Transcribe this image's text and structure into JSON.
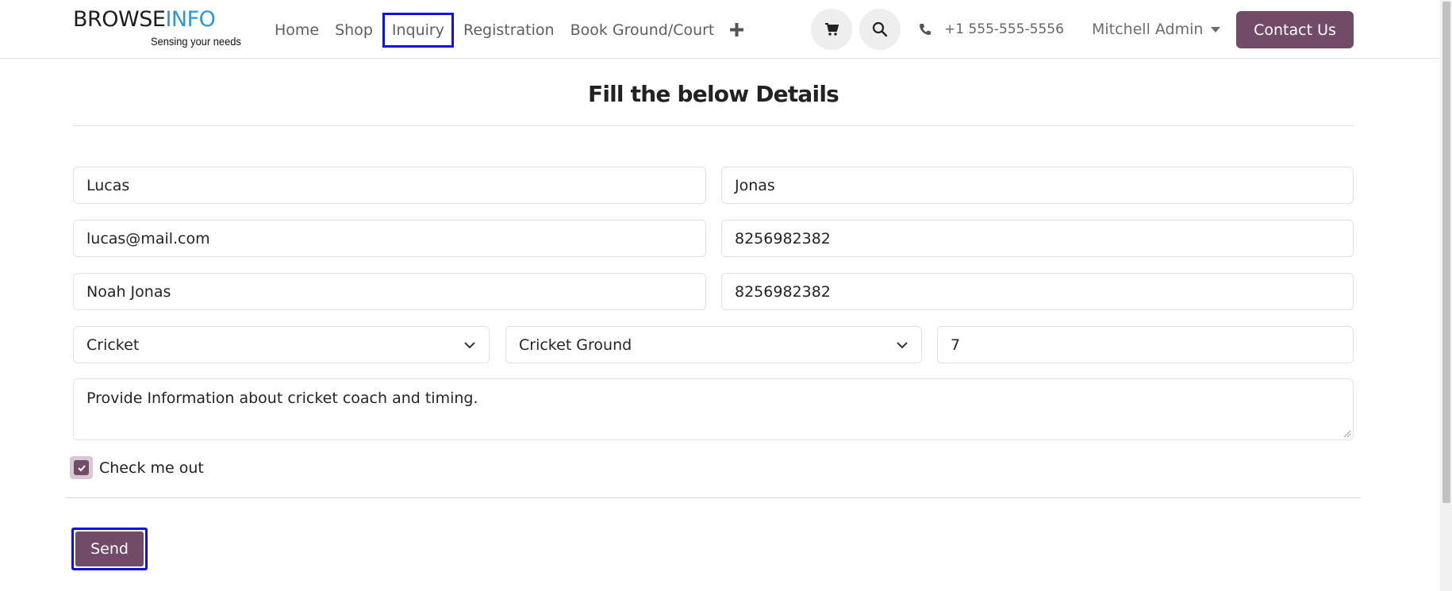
{
  "brand": {
    "logo_dark": "BROWSE",
    "logo_blue": "INFO",
    "tagline": "Sensing your needs"
  },
  "nav": {
    "items": [
      {
        "label": "Home"
      },
      {
        "label": "Shop"
      },
      {
        "label": "Inquiry"
      },
      {
        "label": "Registration"
      },
      {
        "label": "Book Ground/Court"
      }
    ],
    "more_icon": "plus-icon"
  },
  "header": {
    "cart_icon": "cart-icon",
    "search_icon": "search-icon",
    "phone_icon": "phone-icon",
    "phone": "+1 555-555-5556",
    "user": "Mitchell Admin",
    "contact_label": "Contact Us"
  },
  "form": {
    "title": "Fill the below Details",
    "first_name": "Lucas",
    "last_name": "Jonas",
    "email": "lucas@mail.com",
    "phone": "8256982382",
    "guardian_name": "Noah Jonas",
    "guardian_phone": "8256982382",
    "sport": "Cricket",
    "ground": "Cricket Ground",
    "count": "7",
    "message": "Provide Information about cricket coach and timing.",
    "checkbox_label": "Check me out",
    "checkbox_checked": true,
    "send_label": "Send"
  },
  "colors": {
    "accent": "#714b67",
    "highlight": "#1010e0",
    "logo_blue": "#2d97d8"
  }
}
